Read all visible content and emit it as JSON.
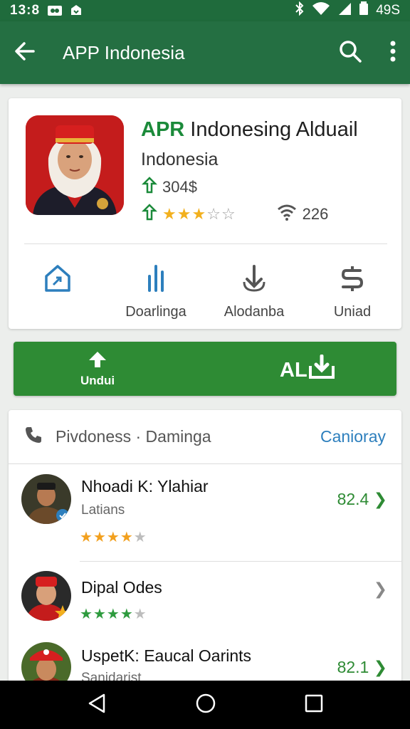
{
  "status_bar": {
    "time": "13:8",
    "battery": "49S"
  },
  "app_bar": {
    "title": "APP Indonesia",
    "icons": [
      "back-arrow-icon",
      "search-icon",
      "more-vert-icon"
    ]
  },
  "app_card": {
    "title_accent": "APR",
    "title_rest": " Indonesing Alduail",
    "subtitle": "Indonesia",
    "downloads": "304$",
    "rating_stars": 3,
    "wifi_count": "226",
    "actions": [
      {
        "icon": "home-share-icon",
        "label": ""
      },
      {
        "icon": "chart-icon",
        "label": "Doarlinga"
      },
      {
        "icon": "download-arrow-icon",
        "label": "Alodanba"
      },
      {
        "icon": "dollar-icon",
        "label": "Uniad"
      }
    ]
  },
  "install": {
    "left_label": "Undui",
    "right_label": "AL"
  },
  "list": {
    "header_text": "Pivdoness · Daminga",
    "header_link": "Canioray",
    "items": [
      {
        "name": "Nhoadi K: Ylahiar",
        "sub": "Latians",
        "rating": 4,
        "value": "82.4",
        "star_color": "#f2a01e"
      },
      {
        "name": "Dipal Odes",
        "sub": "",
        "rating": 4,
        "value": "",
        "star_color": "#2e9b3e"
      },
      {
        "name": "UspetK: Eaucal Oarints",
        "sub": "Sanidarist",
        "rating": 0,
        "value": "82.1",
        "star_color": "#2e9b3e"
      }
    ]
  },
  "colors": {
    "app_bar": "#246f42",
    "install_button": "#2e8b34",
    "accent_green": "#1b8a3a",
    "link_blue": "#2d7fbd"
  }
}
